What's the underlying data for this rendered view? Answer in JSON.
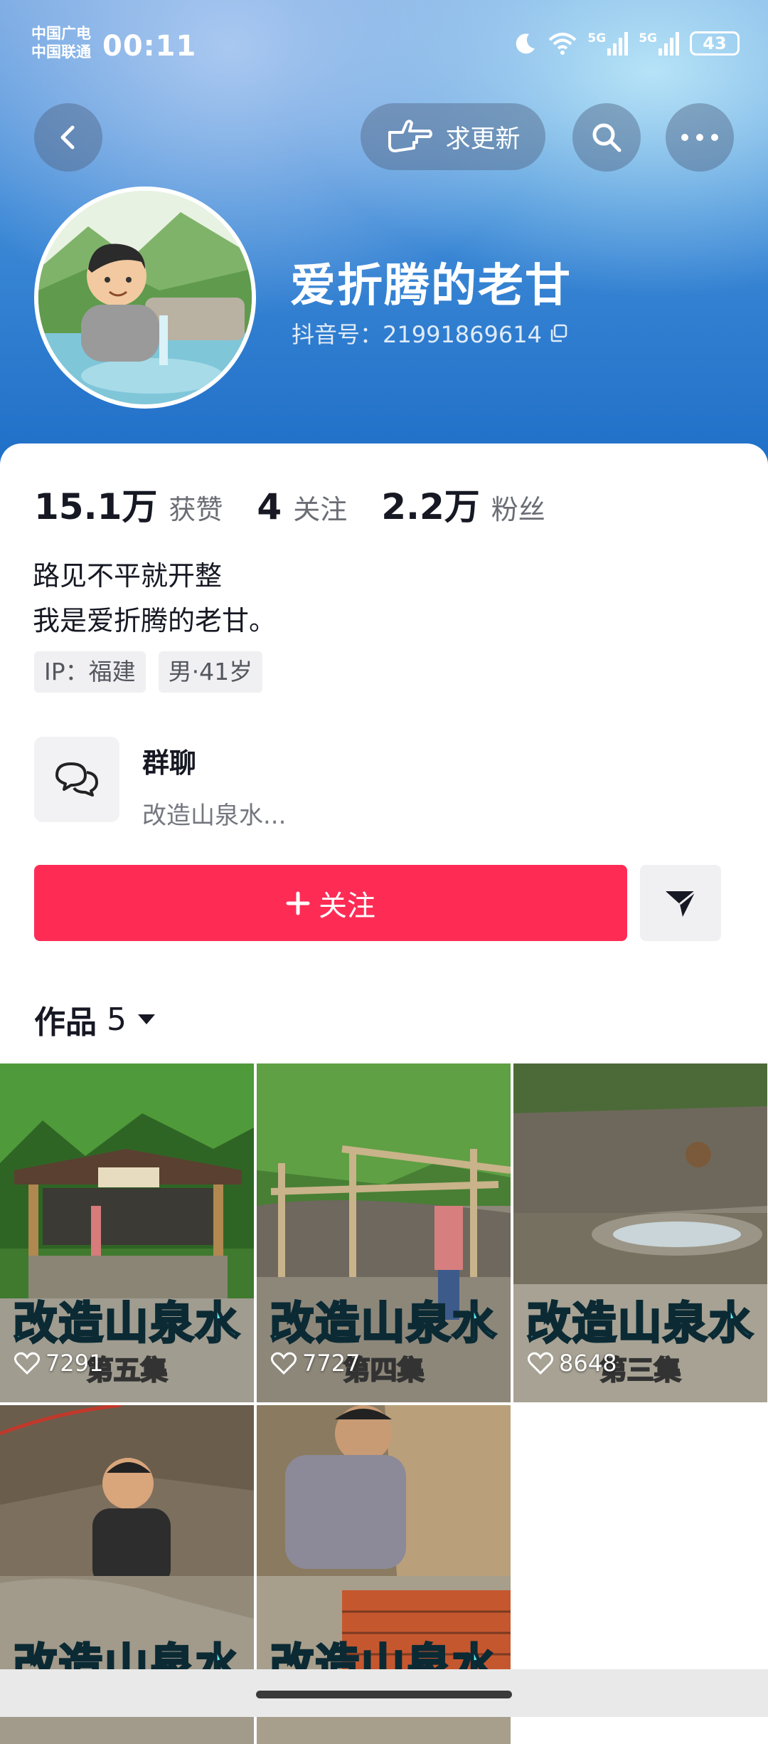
{
  "status_bar": {
    "carrier_1": "中国广电",
    "carrier_2": "中国联通",
    "time": "00:11",
    "signal_1": "5G",
    "signal_2": "5G",
    "battery": "43"
  },
  "top_bar": {
    "update_label": "求更新"
  },
  "profile": {
    "name": "爱折腾的老甘",
    "account_id": "抖音号：21991869614"
  },
  "stats": [
    {
      "value": "15.1万",
      "label": "获赞"
    },
    {
      "value": "4",
      "label": "关注"
    },
    {
      "value": "2.2万",
      "label": "粉丝"
    }
  ],
  "bio": {
    "line1": "路见不平就开整",
    "line2": "我是爱折腾的老甘。"
  },
  "tags": [
    "IP：福建",
    "男·41岁"
  ],
  "group_chat": {
    "title": "群聊",
    "subtitle": "改造山泉水..."
  },
  "actions": {
    "follow_label": "关注"
  },
  "works": {
    "label": "作品",
    "count": "5"
  },
  "videos": [
    {
      "title": "改造山泉水",
      "episode": "第五集",
      "likes": "7291"
    },
    {
      "title": "改造山泉水",
      "episode": "第四集",
      "likes": "7727"
    },
    {
      "title": "改造山泉水",
      "episode": "第三集",
      "likes": "8648"
    },
    {
      "title": "改造山泉水",
      "episode": "",
      "likes": ""
    },
    {
      "title": "改造山泉水",
      "episode": "",
      "likes": ""
    }
  ],
  "colors": {
    "accent": "#fe2c55",
    "header": "#3d89d6",
    "thumb_title": "#5ef0f8"
  }
}
